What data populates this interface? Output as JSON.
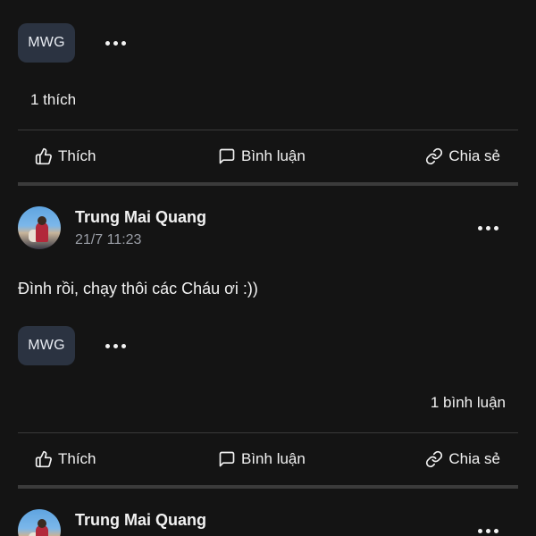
{
  "tag_label": "MWG",
  "actions": {
    "like": "Thích",
    "comment": "Bình luận",
    "share": "Chia sẻ"
  },
  "post1": {
    "likes": "1 thích"
  },
  "post2": {
    "author": "Trung Mai Quang",
    "time": "21/7 11:23",
    "text": "Đình rồi, chạy thôi các Cháu ơi :))",
    "comments": "1 bình luận"
  },
  "post3": {
    "author": "Trung Mai Quang"
  },
  "icons": [
    "more-horizontal-icon",
    "thumbs-up-icon",
    "comment-icon",
    "link-icon"
  ]
}
